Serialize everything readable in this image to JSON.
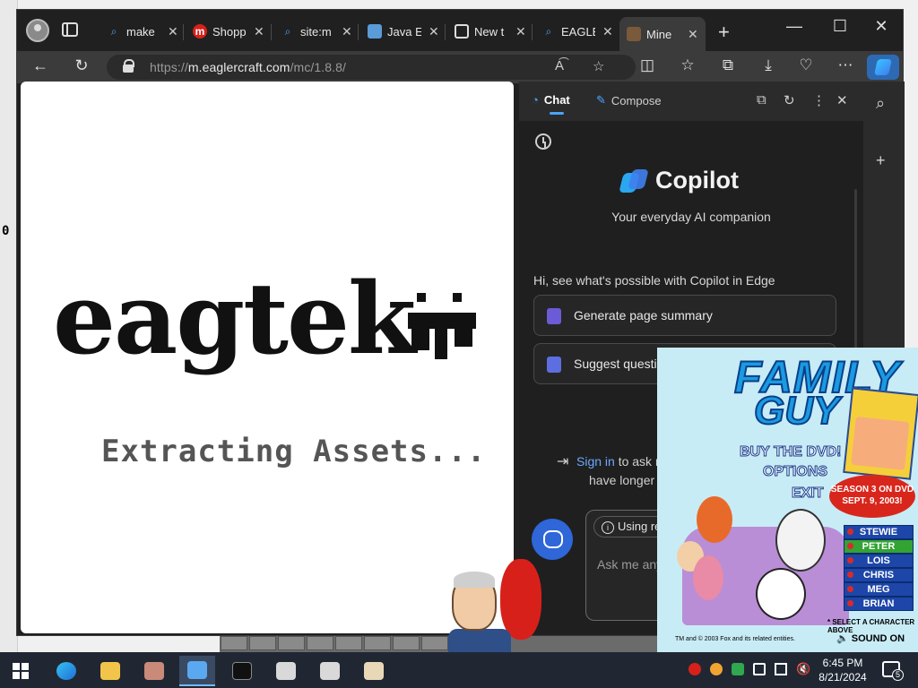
{
  "browser": {
    "tabs": [
      {
        "label": "make",
        "icon": "search-icon"
      },
      {
        "label": "Shopp",
        "icon": "m-badge-icon"
      },
      {
        "label": "site:m",
        "icon": "search-icon"
      },
      {
        "label": "Java E",
        "icon": "cube-icon"
      },
      {
        "label": "New t",
        "icon": "newtab-icon"
      },
      {
        "label": "EAGLE",
        "icon": "search-icon"
      },
      {
        "label": "Mine",
        "icon": "block-icon"
      }
    ],
    "address": {
      "prefix": "https://",
      "host": "m.eaglercraft.com",
      "path": "/mc/1.8.8/"
    }
  },
  "page": {
    "logo_text": "eagtek",
    "status_text": "Extracting Assets..."
  },
  "sidebar": {
    "tab_chat": "Chat",
    "tab_compose": "Compose",
    "brand": "Copilot",
    "tagline": "Your everyday AI companion",
    "greeting": "Hi, see what's possible with Copilot in Edge",
    "suggestions": [
      "Generate page summary",
      "Suggest questions about this"
    ],
    "signin_link": "Sign in",
    "signin_rest_1": "to ask more que",
    "signin_rest_2": "have longer conversa",
    "using_chip": "Using relevant s",
    "input_placeholder": "Ask me anyt"
  },
  "ad": {
    "title_line1": "FAMILY",
    "title_line2": "GUY",
    "option_1": "BUY THE DVD!",
    "option_2": "OPTIONS",
    "option_3": "EXIT",
    "season_line1": "SEASON 3 ON DVD",
    "season_line2": "SEPT. 9, 2003!",
    "characters": [
      "STEWIE",
      "PETER",
      "LOIS",
      "CHRIS",
      "MEG",
      "BRIAN"
    ],
    "selected_character": "PETER",
    "select_prompt": "* SELECT A CHARACTER ABOVE",
    "legal": "TM and © 2003 Fox and its related entities.",
    "sound": "SOUND ON"
  },
  "background": {
    "left_digit": "0"
  },
  "taskbar": {
    "time": "6:45 PM",
    "date": "8/21/2024",
    "notifications": "5"
  },
  "colors": {
    "accent": "#4aa4ff",
    "copilot_blue": "#2f66d8",
    "taskbar": "#202733"
  }
}
